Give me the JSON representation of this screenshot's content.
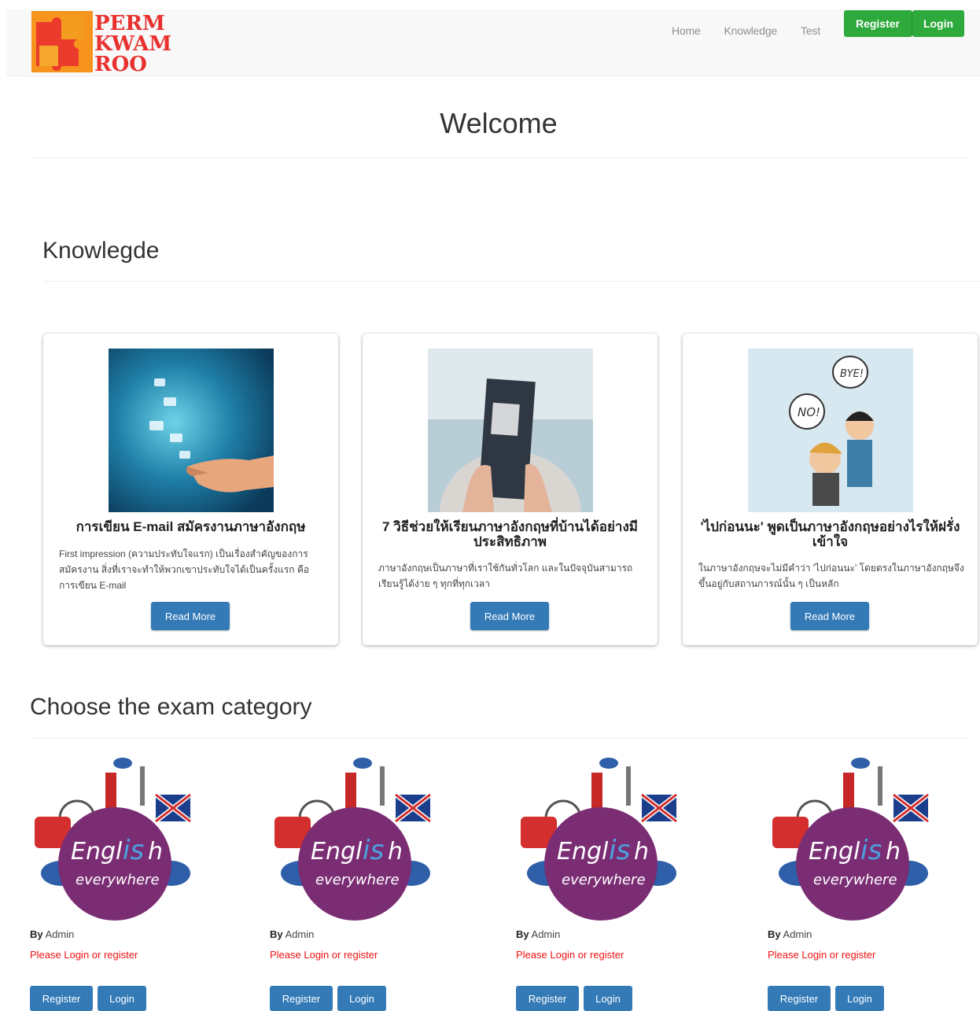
{
  "brand": {
    "logo_lines": [
      "PERM",
      "KWAM",
      "ROO"
    ]
  },
  "nav": {
    "links": [
      "Home",
      "Knowledge",
      "Test"
    ],
    "register": "Register",
    "login": "Login"
  },
  "welcome": "Welcome",
  "knowledge": {
    "title": "Knowlegde",
    "cards": [
      {
        "title": "การเขียน E-mail สมัครงานภาษาอังกฤษ",
        "text": "First impression (ความประทับใจแรก) เป็นเรื่องสำคัญของการสมัครงาน สิ่งที่เราจะทำให้พวกเขาประทับใจได้เป็นครั้งแรก คือ การเขียน E-mail",
        "button": "Read More"
      },
      {
        "title": "7 วิธีช่วยให้เรียนภาษาอังกฤษที่บ้านได้อย่างมีประสิทธิภาพ",
        "text": "ภาษาอังกฤษเป็นภาษาที่เราใช้กันทั่วโลก และในปัจจุบันสามารถเรียนรู้ได้ง่าย ๆ ทุกที่ทุกเวลา",
        "button": "Read More"
      },
      {
        "title": "'ไปก่อนนะ' พูดเป็นภาษาอังกฤษอย่างไรให้ฝรั่งเข้าใจ",
        "text": "ในภาษาอังกฤษจะไม่มีคำว่า 'ไปก่อนนะ' โดยตรงในภาษาอังกฤษจึงขึ้นอยู่กับสถานการณ์นั้น ๆ เป็นหลัก",
        "button": "Read More"
      }
    ]
  },
  "exam": {
    "title": "Choose the exam category",
    "logo_word": "Engl",
    "logo_is": "is",
    "logo_h": "h",
    "logo_sub": "everywhere",
    "items": [
      {
        "by_label": "By",
        "author": "Admin",
        "warning": "Please Login or register",
        "register": "Register",
        "login": "Login"
      },
      {
        "by_label": "By",
        "author": "Admin",
        "warning": "Please Login or register",
        "register": "Register",
        "login": "Login"
      },
      {
        "by_label": "By",
        "author": "Admin",
        "warning": "Please Login or register",
        "register": "Register",
        "login": "Login"
      },
      {
        "by_label": "By",
        "author": "Admin",
        "warning": "Please Login or register",
        "register": "Register",
        "login": "Login"
      }
    ]
  },
  "colors": {
    "nav_green": "#2ea93b",
    "button_blue": "#337ab7",
    "warning_red": "#ee1111",
    "logo_orange": "#f7941d",
    "logo_red": "#e8312f",
    "exam_purple": "#7b2d74"
  },
  "icons": [
    "puzzle-logo-icon",
    "email-hand-image",
    "book-reader-image",
    "bye-no-cartoon-image",
    "english-everywhere-logo"
  ]
}
